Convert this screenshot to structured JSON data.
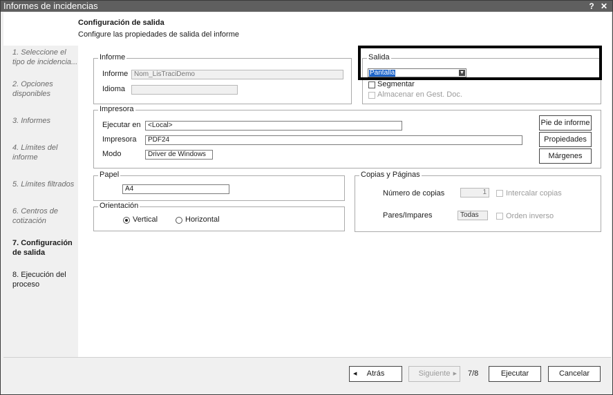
{
  "window": {
    "title": "Informes de incidencias",
    "help_glyph": "?",
    "close_glyph": "✕"
  },
  "header": {
    "title": "Configuración de salida",
    "subtitle": "Configure las propiedades de salida del informe"
  },
  "steps": [
    {
      "label": "1. Seleccione el tipo de incidencia...",
      "state": "done"
    },
    {
      "label": "2. Opciones disponibles",
      "state": "done"
    },
    {
      "label": "3. Informes",
      "state": "done"
    },
    {
      "label": "4. Límites del informe",
      "state": "done"
    },
    {
      "label": "5. Límites filtrados",
      "state": "done"
    },
    {
      "label": "6. Centros de cotización",
      "state": "done"
    },
    {
      "label": "7. Configuración de salida",
      "state": "active"
    },
    {
      "label": "8. Ejecución del proceso",
      "state": "future"
    }
  ],
  "informe": {
    "legend": "Informe",
    "informe_label": "Informe",
    "informe_value": "Nom_LisTraciDemo",
    "idioma_label": "Idioma",
    "idioma_value": ""
  },
  "salida": {
    "legend": "Salida",
    "selected": "Pantalla",
    "segmentar_label": "Segmentar",
    "almacenar_label": "Almacenar en Gest. Doc."
  },
  "impresora": {
    "legend": "Impresora",
    "ejecutar_label": "Ejecutar en",
    "ejecutar_value": "<Local>",
    "impresora_label": "Impresora",
    "impresora_value": "PDF24",
    "modo_label": "Modo",
    "modo_value": "Driver de Windows",
    "pie_button": "Pie de informe",
    "propiedades_button": "Propiedades",
    "margenes_button": "Márgenes"
  },
  "papel": {
    "legend": "Papel",
    "value": "A4"
  },
  "orientacion": {
    "legend": "Orientación",
    "vertical_label": "Vertical",
    "horizontal_label": "Horizontal",
    "selected": "Vertical"
  },
  "copias": {
    "legend": "Copias y Páginas",
    "numero_label": "Número de copias",
    "numero_value": "1",
    "intercalar_label": "Intercalar copias",
    "pares_label": "Pares/Impares",
    "pares_value": "Todas",
    "orden_label": "Orden inverso"
  },
  "footer": {
    "atras_label": "Atrás",
    "siguiente_label": "Siguiente",
    "page_indicator": "7/8",
    "ejecutar_label": "Ejecutar",
    "cancelar_label": "Cancelar"
  },
  "colors": {
    "titlebar": "#5f5f5f",
    "selection": "#1e64c8",
    "highlight_border": "#000000"
  }
}
